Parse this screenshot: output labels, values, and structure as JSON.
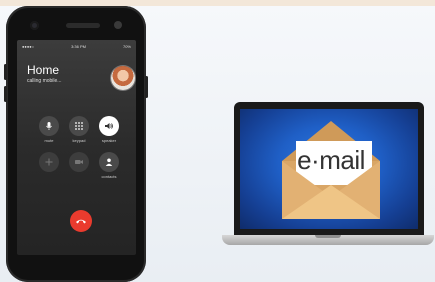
{
  "phone": {
    "status": {
      "carrier": "●●●●○",
      "time": "3:36 PM",
      "battery": "70%"
    },
    "caller_name": "Home",
    "call_status": "calling mobile...",
    "controls": [
      {
        "label": "mute",
        "icon": "microphone-icon"
      },
      {
        "label": "keypad",
        "icon": "keypad-icon"
      },
      {
        "label": "speaker",
        "icon": "speaker-icon"
      },
      {
        "label": "",
        "icon": "add-call-icon"
      },
      {
        "label": "",
        "icon": "video-icon"
      },
      {
        "label": "contacts",
        "icon": "contacts-icon"
      }
    ],
    "end_call_icon": "end-call-icon",
    "end_call_color": "#ea3b2e"
  },
  "laptop": {
    "email_label": "e·mail",
    "envelope_color": "#e7b97d",
    "screen_color": "#1f5fc6"
  }
}
